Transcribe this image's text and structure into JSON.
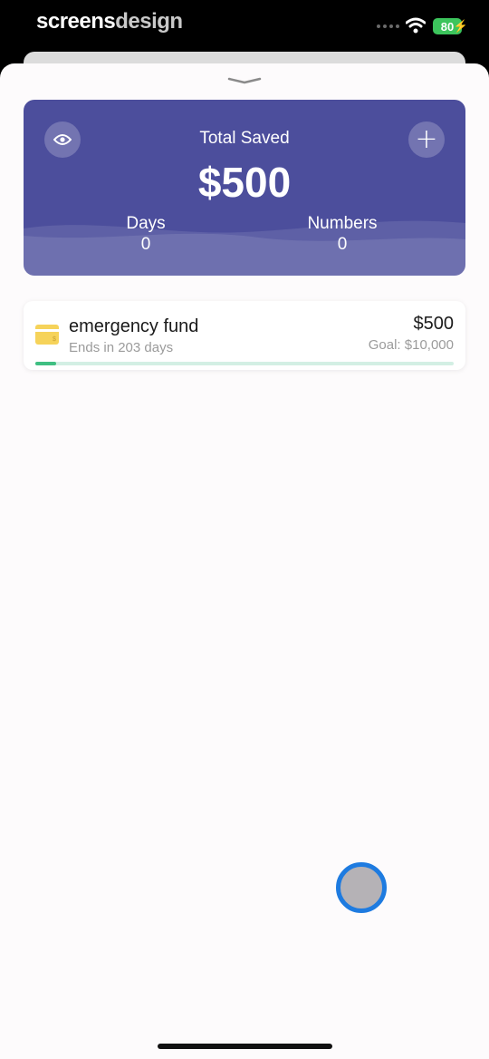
{
  "status_bar": {
    "brand_part1": "screens",
    "brand_part2": "design",
    "battery": "80"
  },
  "summary": {
    "title": "Total Saved",
    "total": "$500",
    "stats": [
      {
        "label": "Days",
        "value": "0"
      },
      {
        "label": "Numbers",
        "value": "0"
      }
    ],
    "eye_icon": "eye-icon",
    "add_icon": "plus-icon",
    "accent": "#4c4e9c"
  },
  "goals": [
    {
      "name": "emergency fund",
      "subtitle": "Ends in 203 days",
      "amount": "$500",
      "goal": "Goal: $10,000",
      "progress": 0.05,
      "icon": "wallet-icon",
      "progress_color": "#3fbf82"
    }
  ]
}
